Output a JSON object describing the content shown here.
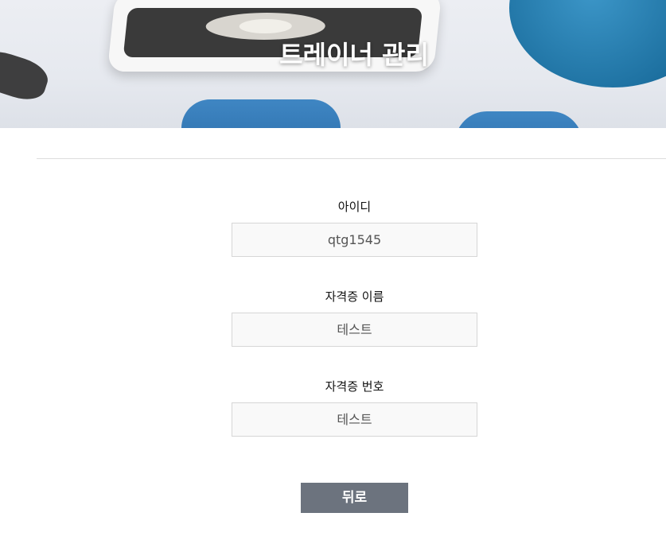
{
  "header": {
    "title": "트레이너 관리"
  },
  "form": {
    "fields": [
      {
        "label": "아이디",
        "value": "qtg1545"
      },
      {
        "label": "자격증 이름",
        "value": "테스트"
      },
      {
        "label": "자격증 번호",
        "value": "테스트"
      }
    ]
  },
  "actions": {
    "back_label": "뒤로"
  },
  "colors": {
    "button_bg": "#6c737e",
    "input_bg": "#f9f9f9"
  }
}
